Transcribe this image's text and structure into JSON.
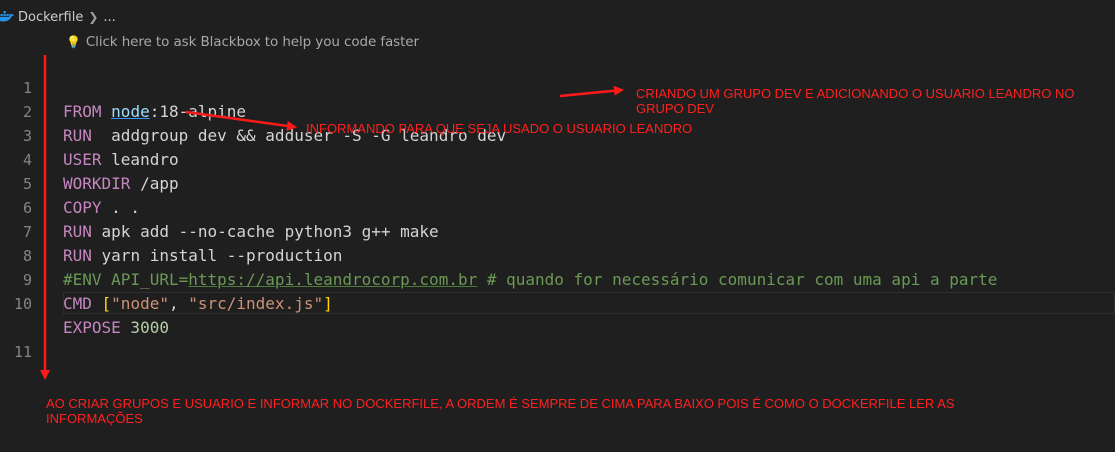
{
  "breadcrumb": {
    "file": "Dockerfile",
    "more": "..."
  },
  "hint": {
    "text": "Click here to ask Blackbox to help you code faster"
  },
  "editor": {
    "line_numbers": [
      "1",
      "2",
      "3",
      "4",
      "5",
      "6",
      "7",
      "8",
      "9",
      "10",
      "11"
    ],
    "lines": {
      "l1": {
        "kw": "FROM",
        "image": "node",
        "tag": ":18-alpine"
      },
      "l2": {
        "kw": "RUN",
        "rest": "  addgroup dev && adduser -S -G leandro dev"
      },
      "l3": {
        "kw": "USER",
        "rest": " leandro"
      },
      "l4": {
        "kw": "WORKDIR",
        "rest": " /app"
      },
      "l5": {
        "kw": "COPY",
        "rest": " . ."
      },
      "l6": {
        "kw": "RUN",
        "rest": " apk add --no-cache python3 g++ make"
      },
      "l7": {
        "kw": "RUN",
        "rest": " yarn install --production"
      },
      "l8": {
        "prefix": "#ENV API_URL=",
        "url": "https://api.leandrocorp.com.br",
        "comment": " # quando for necessário comunicar com uma api a parte"
      },
      "l9": {
        "kw": "CMD",
        "open": " [",
        "s1": "\"node\"",
        "sep": ", ",
        "s2": "\"src/index.js\"",
        "close": "]"
      },
      "l10": {
        "kw": "EXPOSE",
        "num": " 3000"
      }
    }
  },
  "annotations": {
    "group": "CRIANDO UM GRUPO DEV E ADICIONANDO O USUARIO LEANDRO NO GRUPO DEV",
    "user": "INFORMANDO PARA QUE SEJA USADO O USUARIO LEANDRO",
    "order": "AO CRIAR GRUPOS E USUARIO E INFORMAR NO DOCKERFILE, A ORDEM É SEMPRE DE CIMA PARA BAIXO POIS É COMO O DOCKERFILE LER AS INFORMAÇÕES"
  },
  "colors": {
    "background": "#1f1f1f",
    "keyword": "#c586c0",
    "annotation": "#ff2020",
    "comment": "#6a9955"
  },
  "icons": [
    "docker-icon",
    "chevron-right-icon",
    "lightbulb-icon"
  ]
}
